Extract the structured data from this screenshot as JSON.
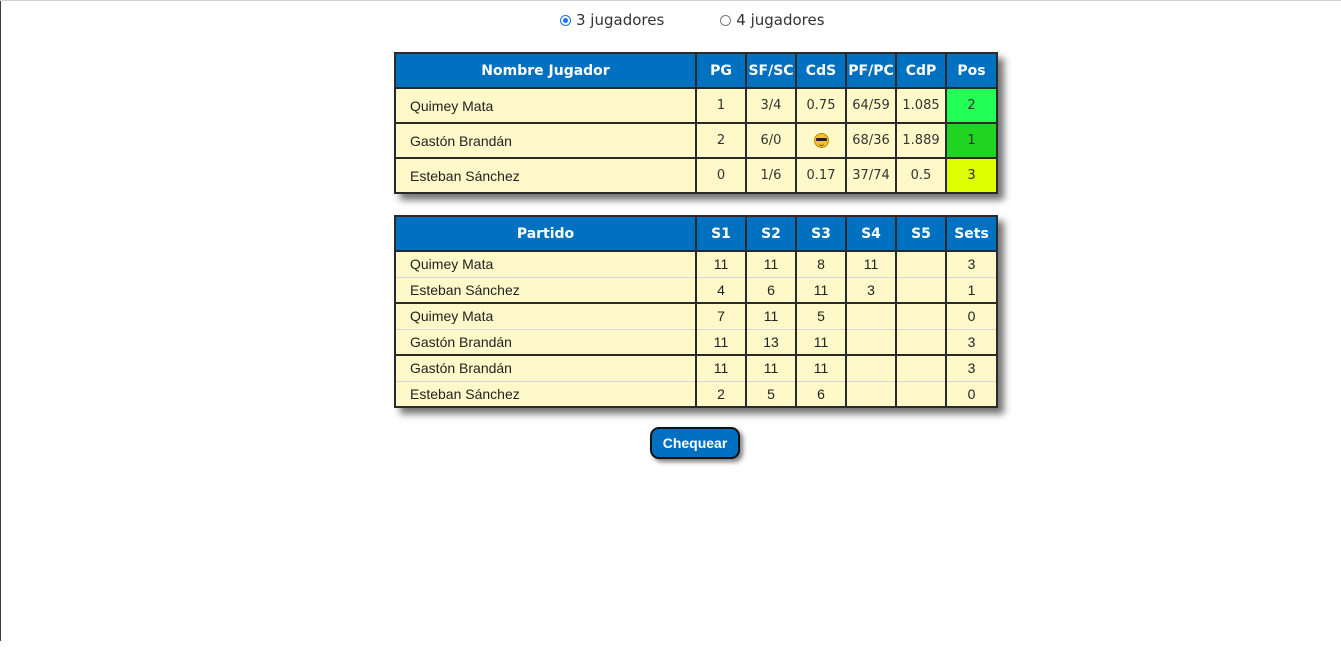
{
  "mode_options": [
    {
      "label": "3 jugadores",
      "selected": true
    },
    {
      "label": "4 jugadores",
      "selected": false
    }
  ],
  "standings": {
    "headers": [
      "Nombre Jugador",
      "PG",
      "SF/SC",
      "CdS",
      "PF/PC",
      "CdP",
      "Pos"
    ],
    "rows": [
      {
        "name": "Quimey Mata",
        "pg": "1",
        "sfsc": "3/4",
        "cds": "0.75",
        "pfpc": "64/59",
        "cdp": "1.085",
        "pos": "2",
        "pos_color": "#22ff55"
      },
      {
        "name": "Gastón Brandán",
        "pg": "2",
        "sfsc": "6/0",
        "cds": "",
        "cds_icon": "smiling-face-with-sunglasses-icon",
        "pfpc": "68/36",
        "cdp": "1.889",
        "pos": "1",
        "pos_color": "#22d422"
      },
      {
        "name": "Esteban Sánchez",
        "pg": "0",
        "sfsc": "1/6",
        "cds": "0.17",
        "pfpc": "37/74",
        "cdp": "0.5",
        "pos": "3",
        "pos_color": "#ddff00"
      }
    ]
  },
  "matches": {
    "headers": [
      "Partido",
      "S1",
      "S2",
      "S3",
      "S4",
      "S5",
      "Sets"
    ],
    "rows": [
      {
        "player": "Quimey Mata",
        "s1": "11",
        "s2": "11",
        "s3": "8",
        "s4": "11",
        "s5": "",
        "sets": "3"
      },
      {
        "player": "Esteban Sánchez",
        "s1": "4",
        "s2": "6",
        "s3": "11",
        "s4": "3",
        "s5": "",
        "sets": "1"
      },
      {
        "player": "Quimey Mata",
        "s1": "7",
        "s2": "11",
        "s3": "5",
        "s4": "",
        "s5": "",
        "sets": "0"
      },
      {
        "player": "Gastón Brandán",
        "s1": "11",
        "s2": "13",
        "s3": "11",
        "s4": "",
        "s5": "",
        "sets": "3"
      },
      {
        "player": "Gastón Brandán",
        "s1": "11",
        "s2": "11",
        "s3": "11",
        "s4": "",
        "s5": "",
        "sets": "3"
      },
      {
        "player": "Esteban Sánchez",
        "s1": "2",
        "s2": "5",
        "s3": "6",
        "s4": "",
        "s5": "",
        "sets": "0"
      }
    ]
  },
  "check_button": {
    "label": "Chequear"
  },
  "colors": {
    "header_bg": "#0070c0",
    "cell_bg": "#fff9c9",
    "radio_accent": "#1a73e8"
  }
}
